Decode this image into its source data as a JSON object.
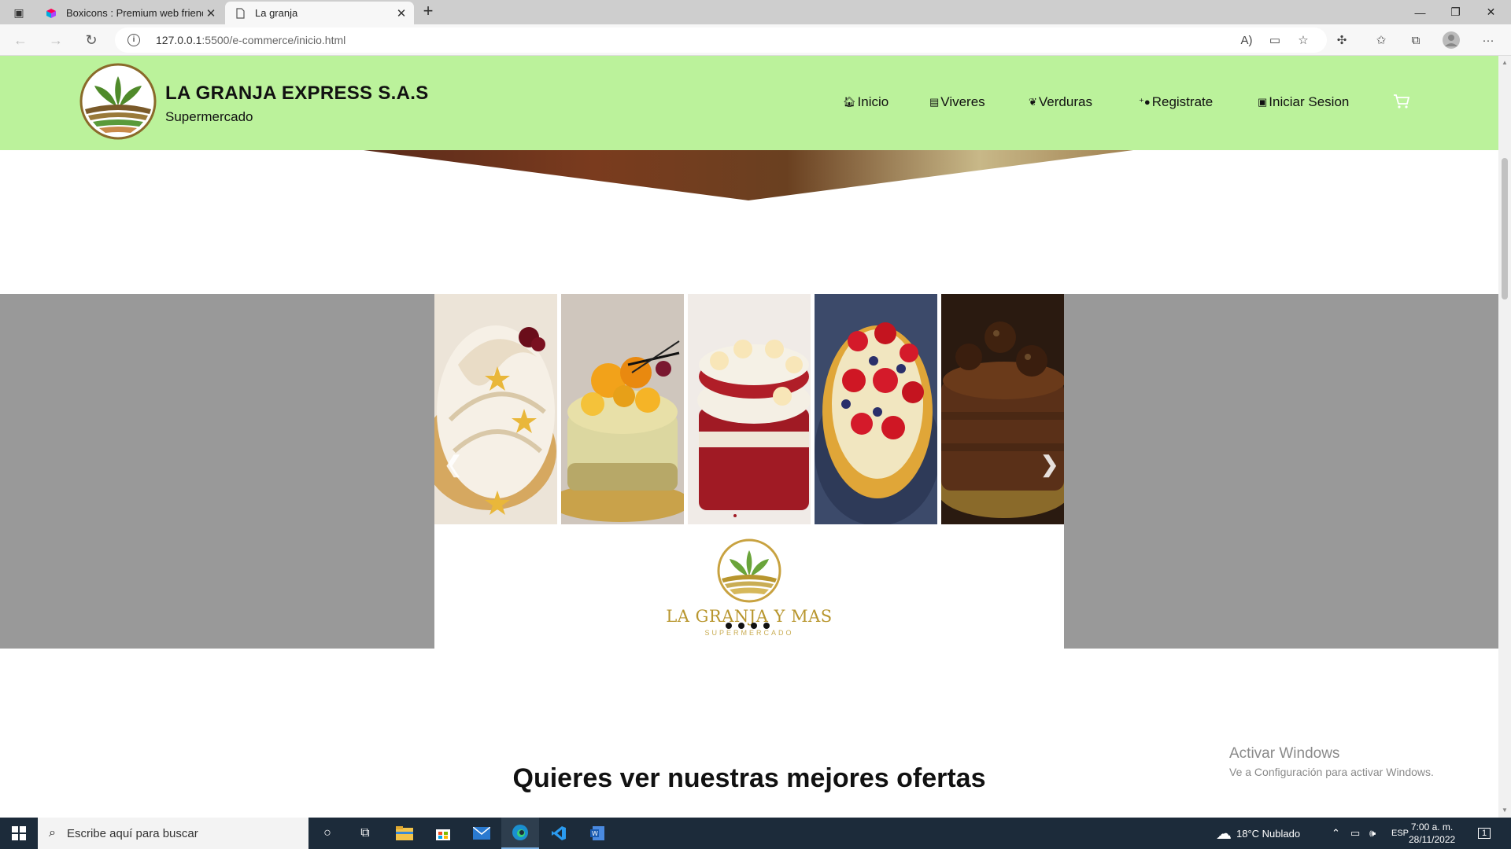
{
  "browser": {
    "tabs": [
      {
        "title": "Boxicons : Premium web friendly",
        "active": false
      },
      {
        "title": "La granja",
        "active": true
      }
    ],
    "address": {
      "host": "127.0.0.1",
      "path": ":5500/e-commerce/inicio.html"
    }
  },
  "header": {
    "brand_title": "LA GRANJA EXPRESS S.A.S",
    "brand_subtitle": "Supermercado",
    "nav": [
      {
        "label": "Inicio",
        "icon": "home-icon"
      },
      {
        "label": "Viveres",
        "icon": "store-icon"
      },
      {
        "label": "Verduras",
        "icon": "leaf-icon"
      },
      {
        "label": "Registrate",
        "icon": "user-plus-icon"
      },
      {
        "label": "Iniciar Sesion",
        "icon": "user-card-icon"
      }
    ],
    "cart_icon": "cart-icon"
  },
  "carousel": {
    "slide_logo_name": "LA GRANJA Y MAS",
    "slide_logo_sub": "SUPERMERCADO",
    "prev": "❮",
    "next": "❯",
    "dots": 4
  },
  "main": {
    "offers_title": "Quieres ver nuestras mejores ofertas"
  },
  "watermark": {
    "title": "Activar Windows",
    "subtitle": "Ve a Configuración para activar Windows."
  },
  "taskbar": {
    "search_placeholder": "Escribe aquí para buscar",
    "weather": "18°C  Nublado",
    "lang": "ESP",
    "time": "7:00 a. m.",
    "date": "28/11/2022",
    "notif_count": "1"
  },
  "colors": {
    "header_bg": "#bbf29b",
    "band_bg": "#999999",
    "gold": "#b8962e"
  }
}
